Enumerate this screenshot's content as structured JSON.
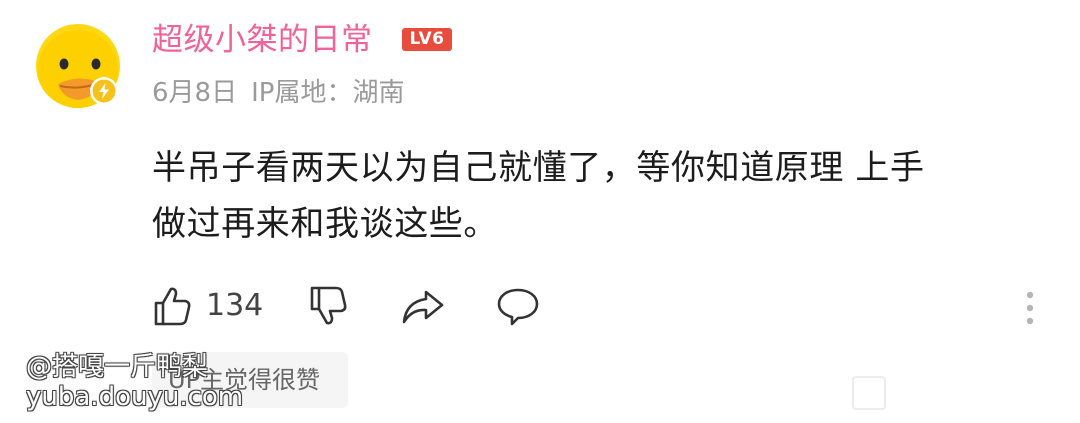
{
  "comment": {
    "username": "超级小桀的日常",
    "level": "LV6",
    "date": "6月8日",
    "ip_location": "IP属地：湖南",
    "content_lines": [
      "半吊子看两天以为自己就懂了，等你知道原理 上手",
      "做过再来和我谈这些。"
    ],
    "like_count": "134",
    "author_reply_tag": "UP主觉得很赞"
  },
  "icons": {
    "avatar": "duck-avatar",
    "verified_badge": "lightning-badge-icon",
    "like": "thumbs-up-icon",
    "dislike": "thumbs-down-icon",
    "share": "share-icon",
    "reply": "comment-icon",
    "more": "more-vertical-icon"
  },
  "watermark": {
    "line1": "@搭嘎一斤鸭梨",
    "line2": "yuba.douyu.com"
  },
  "colors": {
    "username": "#f0639a",
    "level_badge": "#e84c3d",
    "meta_text": "#9a9a9a",
    "body_text": "#1c1c1c",
    "badge_yellow": "#f5c21b"
  }
}
